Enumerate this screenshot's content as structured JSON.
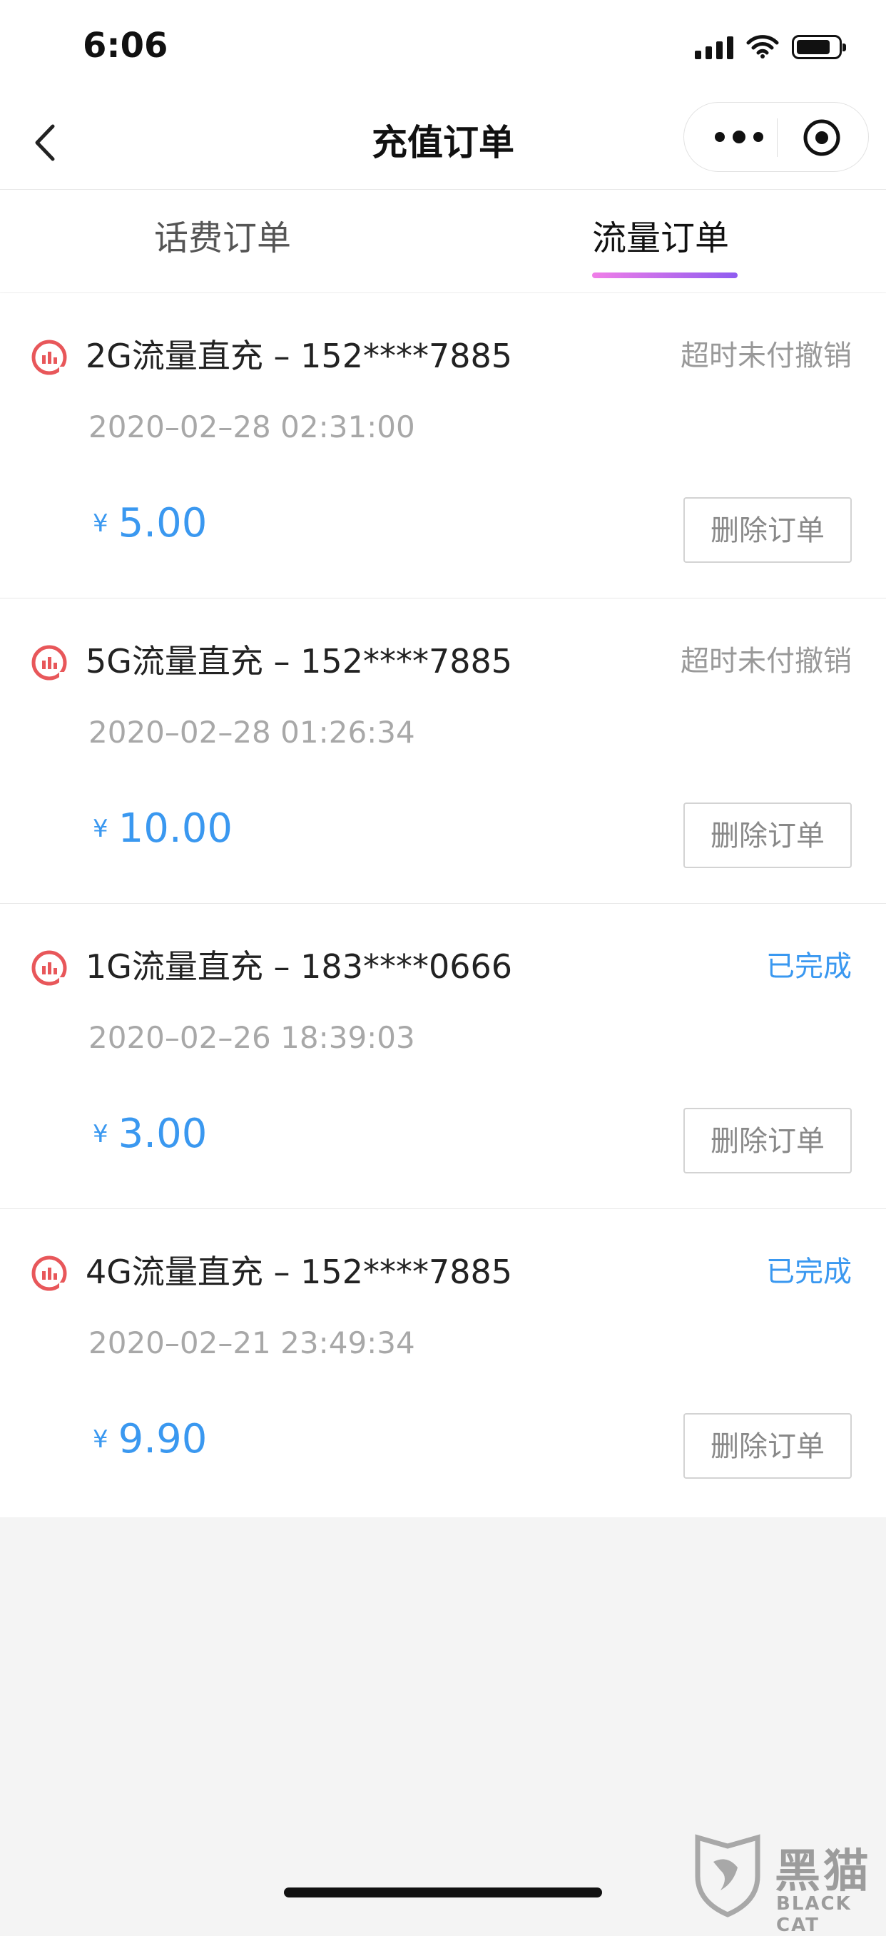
{
  "status_bar": {
    "time": "6:06"
  },
  "nav": {
    "title": "充值订单"
  },
  "tabs": [
    {
      "label": "话费订单",
      "active": false
    },
    {
      "label": "流量订单",
      "active": true
    }
  ],
  "colors": {
    "accent_blue": "#3a98f0",
    "tab_gradient_start": "#f07ee8",
    "tab_gradient_end": "#8f5cf0",
    "icon_red": "#e8575a"
  },
  "orders": [
    {
      "title": "2G流量直充 – 152****7885",
      "status": "超时未付撤销",
      "time": "2020–02–28 02:31:00",
      "currency": "¥",
      "amount": "5.00",
      "button": "删除订单"
    },
    {
      "title": "5G流量直充 – 152****7885",
      "status": "超时未付撤销",
      "time": "2020–02–28 01:26:34",
      "currency": "¥",
      "amount": "10.00",
      "button": "删除订单"
    },
    {
      "title": "1G流量直充 – 183****0666",
      "status": "已完成",
      "time": "2020–02–26 18:39:03",
      "currency": "¥",
      "amount": "3.00",
      "button": "删除订单"
    },
    {
      "title": "4G流量直充 – 152****7885",
      "status": "已完成",
      "time": "2020–02–21 23:49:34",
      "currency": "¥",
      "amount": "9.90",
      "button": "删除订单"
    }
  ],
  "watermark": {
    "text": "黑猫",
    "sub": "BLACK CAT"
  }
}
